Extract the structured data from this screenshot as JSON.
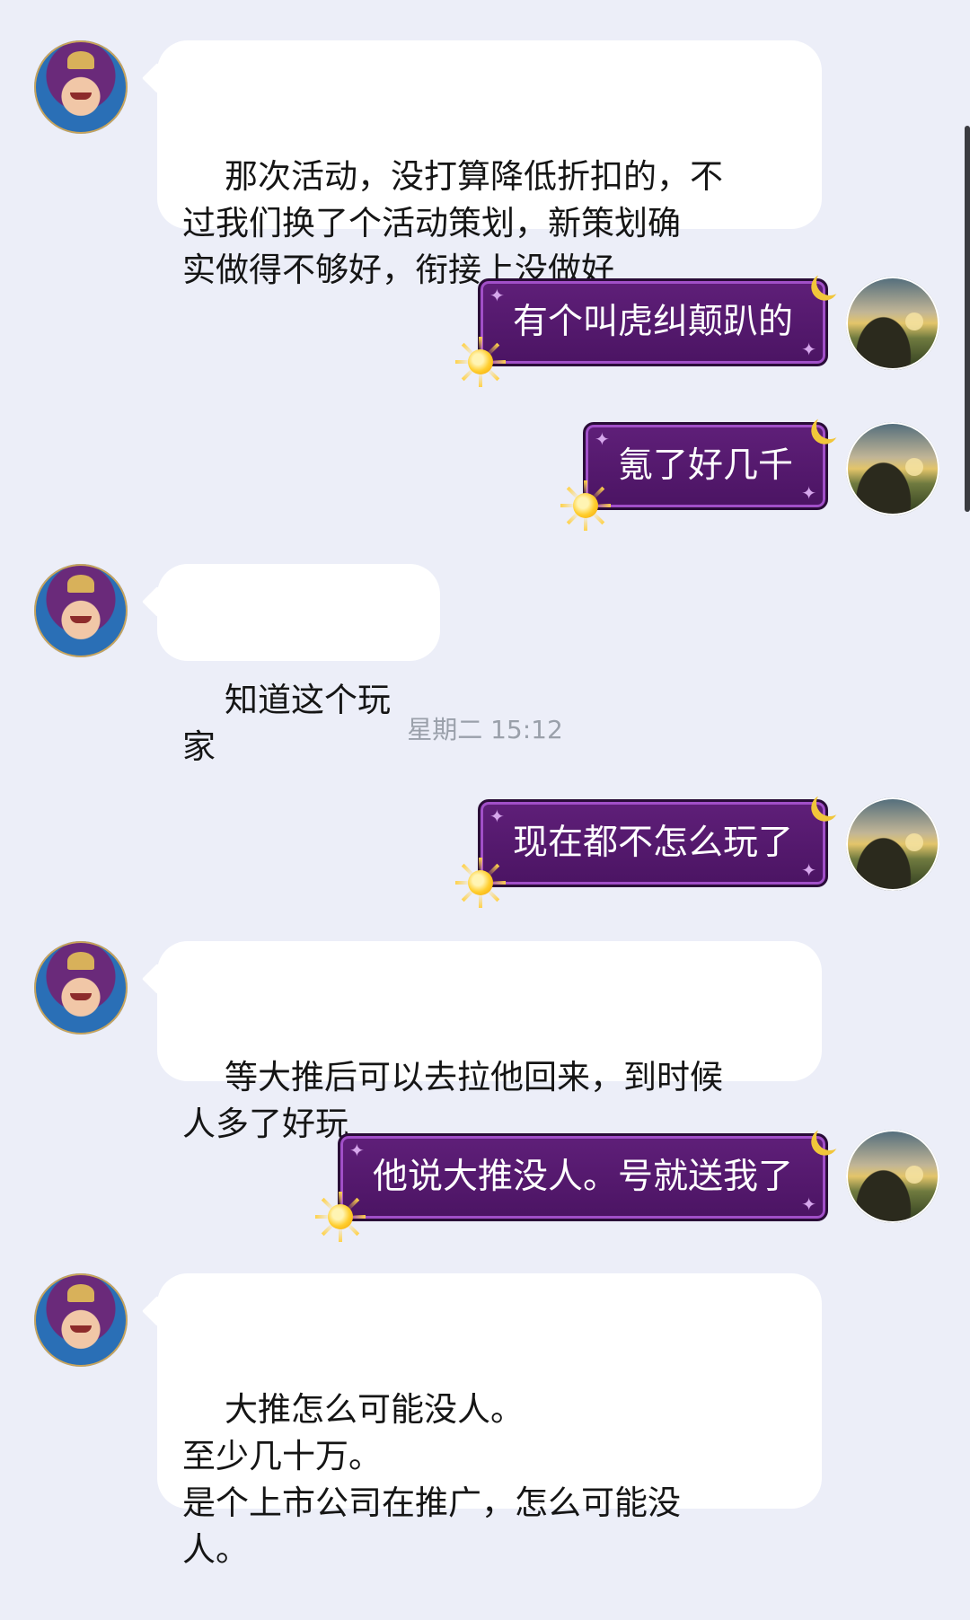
{
  "messages": {
    "m1": {
      "text": "那次活动，没打算降低折扣的，不\n过我们换了个活动策划，新策划确\n实做得不够好，衔接上没做好"
    },
    "m2": {
      "text": "有个叫虎纠颠趴的"
    },
    "m3": {
      "text": "氪了好几千"
    },
    "m4": {
      "text": "知道这个玩家"
    },
    "m5": {
      "text": "现在都不怎么玩了"
    },
    "m6": {
      "text": "等大推后可以去拉他回来，到时候\n人多了好玩"
    },
    "m7": {
      "text": "他说大推没人。号就送我了"
    },
    "m8": {
      "text": "大推怎么可能没人。\n至少几十万。\n是个上市公司在推广，怎么可能没\n人。"
    }
  },
  "timestamp": "星期二 15:12",
  "colors": {
    "background": "#eceef8",
    "incoming_bubble": "#ffffff",
    "outgoing_bubble": "#5f1f79",
    "timestamp_text": "#9aa0aa"
  },
  "icons": {
    "outgoing_decor_top": "crescent-moon-icon",
    "outgoing_decor_bottom": "sun-icon"
  }
}
